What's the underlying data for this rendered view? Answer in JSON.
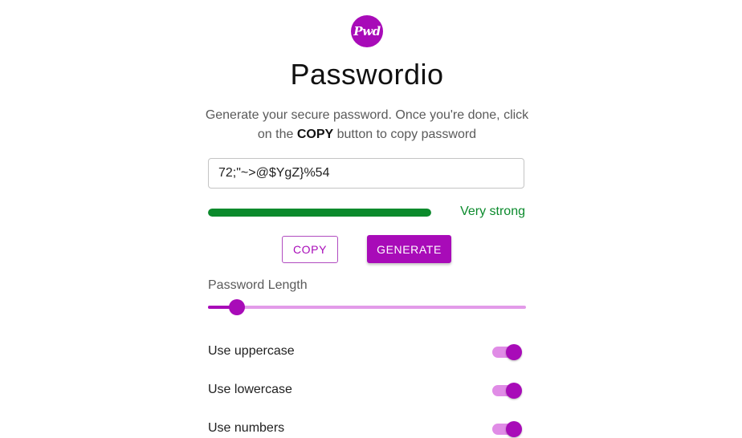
{
  "app": {
    "logo_text": "Pwd",
    "title": "Passwordio",
    "subtitle_before": "Generate your secure password. Once you're done, click on the ",
    "subtitle_bold": "COPY",
    "subtitle_after": " button to copy password"
  },
  "password": {
    "value": "72;\"~>@$YgZ}%54"
  },
  "strength": {
    "label": "Very strong",
    "level": 1.0,
    "color": "#0b8a2c"
  },
  "buttons": {
    "copy_label": "COPY",
    "generate_label": "GENERATE"
  },
  "length": {
    "label": "Password Length",
    "fraction": 0.09
  },
  "options": [
    {
      "label": "Use uppercase",
      "enabled": true
    },
    {
      "label": "Use lowercase",
      "enabled": true
    },
    {
      "label": "Use numbers",
      "enabled": true
    }
  ],
  "colors": {
    "accent": "#a80bb8",
    "accent_light": "#e39be9",
    "strength_good": "#0b8a2c"
  }
}
